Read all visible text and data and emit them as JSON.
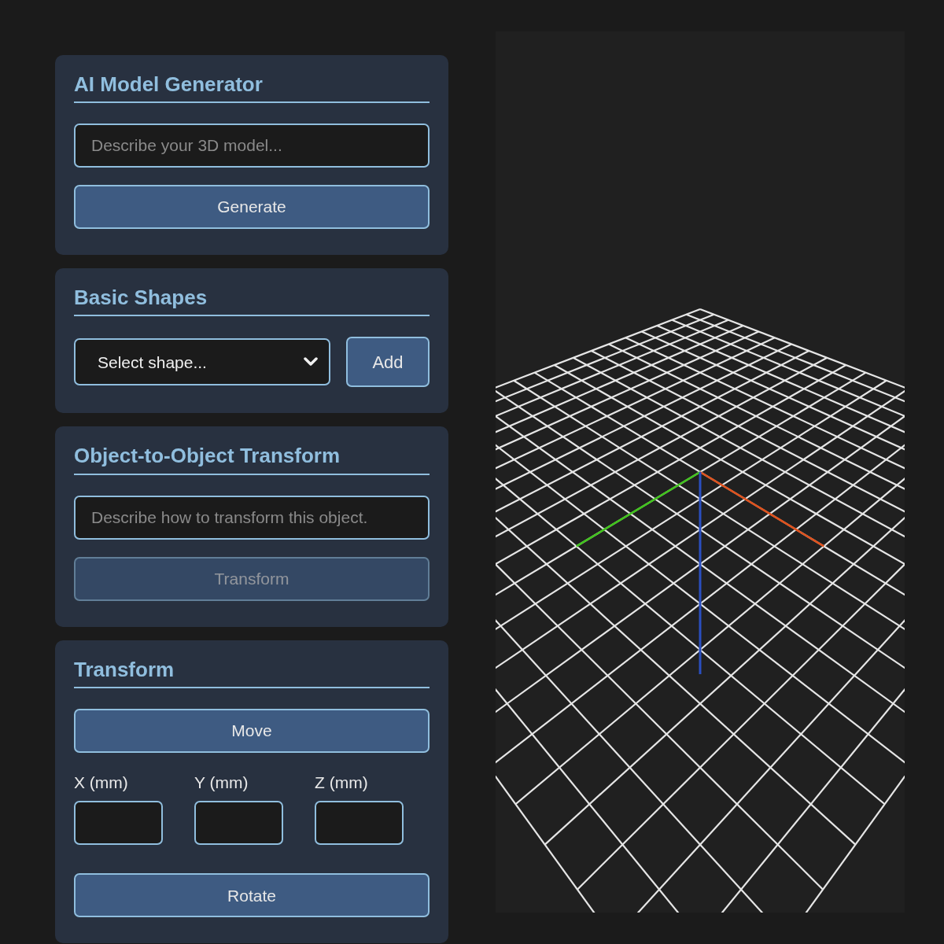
{
  "panels": [
    {
      "title": "AI Model Generator",
      "controls": [
        {
          "kind": "text-input",
          "placeholder": "Describe your 3D model..."
        },
        {
          "kind": "button",
          "label": "Generate",
          "disabled": false
        }
      ]
    },
    {
      "title": "Basic Shapes",
      "controls": [
        {
          "kind": "select-row",
          "select": "Select shape...",
          "button": "Add"
        }
      ]
    },
    {
      "title": "Object-to-Object Transform",
      "controls": [
        {
          "kind": "text-input",
          "placeholder": "Describe how to transform this object."
        },
        {
          "kind": "button",
          "label": "Transform",
          "disabled": true
        }
      ]
    },
    {
      "title": "Transform",
      "controls": [
        {
          "kind": "button",
          "label": "Move",
          "disabled": false
        },
        {
          "kind": "xyz",
          "fields": [
            {
              "label": "X (mm)"
            },
            {
              "label": "Y (mm)"
            },
            {
              "label": "Z (mm)"
            }
          ]
        },
        {
          "kind": "button",
          "label": "Rotate",
          "disabled": false
        }
      ]
    }
  ]
}
